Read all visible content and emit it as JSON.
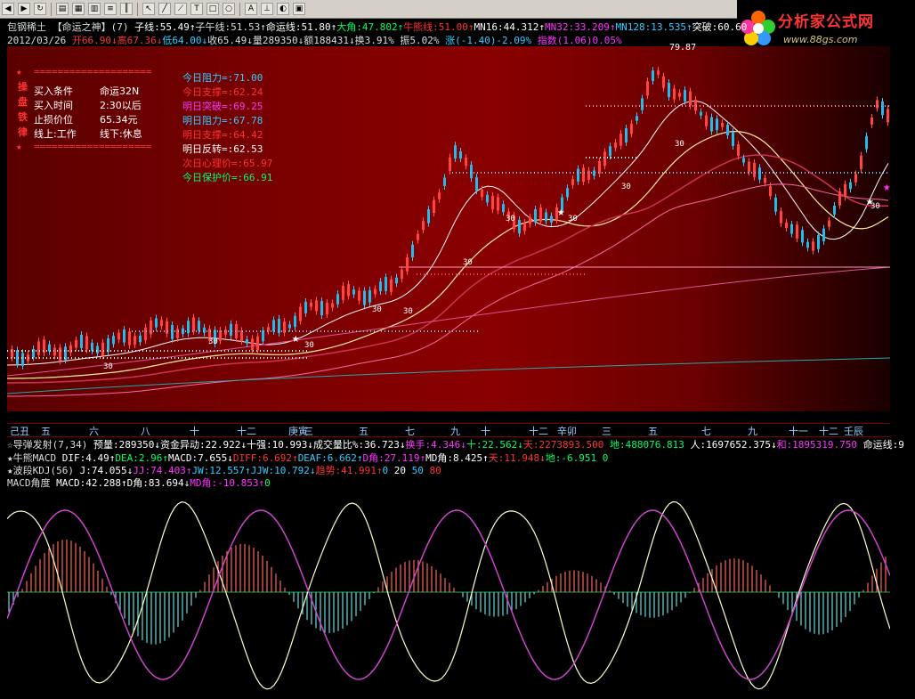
{
  "toolbar": {
    "icons": [
      "back-icon",
      "forward-icon",
      "refresh-icon",
      "chart-icon",
      "grid-icon",
      "table-icon",
      "list-icon",
      "bars-icon",
      "cursor-icon",
      "line-icon",
      "fan-icon",
      "text-icon",
      "rect-icon",
      "circle-icon",
      "font-icon",
      "ruler-icon",
      "palette-icon",
      "save-icon"
    ]
  },
  "logo": {
    "title": "分析家公式网",
    "url": "www.88gs.com"
  },
  "info_line1": [
    {
      "text": "包钢稀土 【命运之神】(7) ",
      "color": "#dddddd"
    },
    {
      "text": "子线:55.49↑",
      "color": "#ffffff"
    },
    {
      "text": "子午线:51.53↑",
      "color": "#dddddd"
    },
    {
      "text": "命运线:51.80↑",
      "color": "#ffffff"
    },
    {
      "text": "大角:47.802↑",
      "color": "#00ff66"
    },
    {
      "text": "牛熊线:51.00↑",
      "color": "#ff3333"
    },
    {
      "text": "MN16:44.312↑",
      "color": "#ffffff"
    },
    {
      "text": "MN32:33.209↑",
      "color": "#ff33ff"
    },
    {
      "text": "MN128:13.535↑",
      "color": "#33ccff"
    },
    {
      "text": "突破:60.60",
      "color": "#ffffff"
    }
  ],
  "info_line2": [
    {
      "text": "2012/03/26 ",
      "color": "#dddddd"
    },
    {
      "text": "开66.90↓",
      "color": "#ff3333"
    },
    {
      "text": "高67.36↓",
      "color": "#ff3333"
    },
    {
      "text": "低64.00↓",
      "color": "#33ccff"
    },
    {
      "text": "收65.49↓",
      "color": "#dddddd"
    },
    {
      "text": "量289350↓",
      "color": "#dddddd"
    },
    {
      "text": "额188431↓",
      "color": "#dddddd"
    },
    {
      "text": "换3.91% ",
      "color": "#dddddd"
    },
    {
      "text": "振5.02% ",
      "color": "#dddddd"
    },
    {
      "text": "涨(-1.40)-2.09% ",
      "color": "#33ccff"
    },
    {
      "text": "指数(1.06)0.05%",
      "color": "#ff33ff"
    }
  ],
  "panel_left": {
    "rule": "====================",
    "rows": [
      {
        "label": "买入条件",
        "value": "命运32N"
      },
      {
        "label": "买入时间",
        "value": "2:30以后"
      },
      {
        "label": "止损价位",
        "value": "65.34元"
      },
      {
        "label": "线上:工作",
        "value": "线下:休息"
      }
    ],
    "side_chars": [
      "操",
      "盘",
      "铁",
      "律"
    ]
  },
  "panel_right": [
    {
      "text": "今日阻力=:71.00",
      "color": "#33ccff"
    },
    {
      "text": "今日支撑=:62.24",
      "color": "#ff3333"
    },
    {
      "text": "明日突破=:69.25",
      "color": "#ff33ff"
    },
    {
      "text": "明日阻力=:67.78",
      "color": "#33ccff"
    },
    {
      "text": "明日支撑=:64.42",
      "color": "#ff3333"
    },
    {
      "text": "明日反转=:62.53",
      "color": "#ffffff"
    },
    {
      "text": "次日心理价=:65.97",
      "color": "#ff3333"
    },
    {
      "text": "今日保护价=:66.91",
      "color": "#00ff66"
    }
  ],
  "chart_labels": {
    "peak": "79.87",
    "marker": "30"
  },
  "axis_ticks": [
    "己丑",
    "五",
    "六",
    "八",
    "十",
    "十二",
    "庚寅",
    "三",
    "五",
    "七",
    "九",
    "十",
    "十二",
    "辛卯",
    "三",
    "五",
    "七",
    "九",
    "十一",
    "十二",
    "壬辰"
  ],
  "indicators": {
    "line1": [
      {
        "text": "☆导弹发射(7,34) ",
        "color": "#dddddd"
      },
      {
        "text": "预量:289350↓",
        "color": "#ffffff"
      },
      {
        "text": "资金异动:22.922↓",
        "color": "#ffffff"
      },
      {
        "text": "十强:10.993↓",
        "color": "#ffffff"
      },
      {
        "text": "成交量比%:36.723↓",
        "color": "#ffffff"
      },
      {
        "text": "换手:4.346↓",
        "color": "#ff33ff"
      },
      {
        "text": "十:22.562↓",
        "color": "#00ff66"
      },
      {
        "text": "天:2273893.500 ",
        "color": "#ff3333"
      },
      {
        "text": "地:488076.813 ",
        "color": "#00ff66"
      },
      {
        "text": "人:1697652.375↓",
        "color": "#ffffff"
      },
      {
        "text": "和:1895319.750 ",
        "color": "#ff33ff"
      },
      {
        "text": "命运线:9",
        "color": "#ffffff"
      }
    ],
    "line2": [
      {
        "text": "★牛熊MACD ",
        "color": "#dddddd"
      },
      {
        "text": "DIF:4.49↑",
        "color": "#ffffff"
      },
      {
        "text": "DEA:2.96↑",
        "color": "#00ff66"
      },
      {
        "text": "MACD:7.655↓",
        "color": "#ffffff"
      },
      {
        "text": "DIFF:6.692↑",
        "color": "#ff3333"
      },
      {
        "text": "DEAF:6.662↑",
        "color": "#33ccff"
      },
      {
        "text": "D角:27.119↑",
        "color": "#ff33ff"
      },
      {
        "text": "MD角:8.425↑",
        "color": "#ffffff"
      },
      {
        "text": "天:11.948↓",
        "color": "#ff3333"
      },
      {
        "text": "地:-6.951 0",
        "color": "#00ff66"
      }
    ],
    "line3": [
      {
        "text": "★波段KDJ(56) ",
        "color": "#dddddd"
      },
      {
        "text": "J:74.055↓",
        "color": "#ffffff"
      },
      {
        "text": "JJ:74.403↑",
        "color": "#ff33ff"
      },
      {
        "text": "JW:12.557↑",
        "color": "#33ccff"
      },
      {
        "text": "JJW:10.792↓",
        "color": "#33ccff"
      },
      {
        "text": "趋势:41.991↑",
        "color": "#ff3333"
      },
      {
        "text": "0 ",
        "color": "#33ccff"
      },
      {
        "text": "20 ",
        "color": "#ffffff"
      },
      {
        "text": "50 ",
        "color": "#33ccff"
      },
      {
        "text": "80",
        "color": "#ff3333"
      }
    ],
    "line4": [
      {
        "text": "MACD角度 ",
        "color": "#dddddd"
      },
      {
        "text": "MACD:42.288↑",
        "color": "#ffffff"
      },
      {
        "text": "D角:83.694↓",
        "color": "#ffffff"
      },
      {
        "text": "MD角:-10.853↑",
        "color": "#ff33ff"
      },
      {
        "text": "0",
        "color": "#00ff66"
      }
    ]
  },
  "colors": {
    "bg": "#000000",
    "up": "#ff3333",
    "down": "#33ccff",
    "accent": "#ff33ff"
  }
}
